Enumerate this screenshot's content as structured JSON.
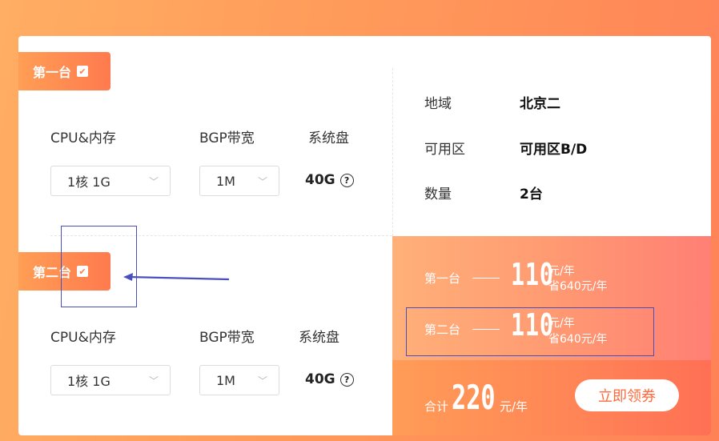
{
  "server1": {
    "tag": "第一台",
    "cpu_label": "CPU&内存",
    "cpu_value": "1核 1G",
    "bw_label": "BGP带宽",
    "bw_value": "1M",
    "disk_label": "系统盘",
    "disk_value": "40G"
  },
  "server2": {
    "tag": "第二台",
    "cpu_label": "CPU&内存",
    "cpu_value": "1核 1G",
    "bw_label": "BGP带宽",
    "bw_value": "1M",
    "disk_label": "系统盘",
    "disk_value": "40G"
  },
  "info": {
    "region_label": "地域",
    "region_value": "北京二",
    "zone_label": "可用区",
    "zone_value": "可用区B/D",
    "qty_label": "数量",
    "qty_value": "2台"
  },
  "prices": [
    {
      "name": "第一台",
      "price": "110",
      "unit": "元/年",
      "save": "省640元/年"
    },
    {
      "name": "第二台",
      "price": "110",
      "unit": "元/年",
      "save": "省640元/年"
    }
  ],
  "total": {
    "label": "合计",
    "price": "220",
    "unit": "元/年",
    "button": "立即领券"
  },
  "colors": {
    "accent": "#ff7a4e",
    "annotation": "#4a4fbf"
  },
  "icons": {
    "check": "check-icon",
    "chevron": "chevron-down-icon",
    "help": "help-icon",
    "arrow": "arrow-left-icon"
  }
}
